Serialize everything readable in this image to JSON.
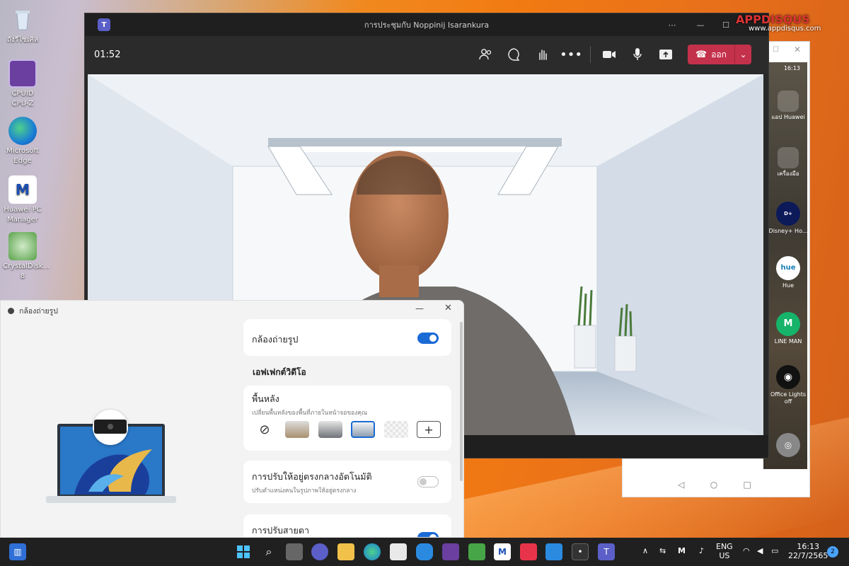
{
  "desktop": {
    "icons": [
      {
        "label": "ถังรีไซเคิล",
        "icon": "recycle-bin-icon"
      },
      {
        "label": "CPUID CPU-Z",
        "icon": "cpuz-icon"
      },
      {
        "label": "Microsoft Edge",
        "icon": "edge-icon"
      },
      {
        "label": "Huawei PC Manager",
        "icon": "huawei-pc-manager-icon"
      },
      {
        "label": "CrystalDisk... 8",
        "icon": "crystaldisk-icon"
      }
    ]
  },
  "teams": {
    "window_title": "การประชุมกับ Noppinij Isarankura",
    "timer": "01:52",
    "leave_label": "ออก",
    "accent": "#c4314b"
  },
  "watermark": {
    "logo": "APPDISQUS",
    "url": "www.appdisqus.com"
  },
  "phone": {
    "status_time": "16:13",
    "apps": [
      {
        "label": "แอป Huawei"
      },
      {
        "label": "เครื่องมือ"
      },
      {
        "label": "Disney+ Ho..."
      },
      {
        "label": "Hue"
      },
      {
        "label": "LINE MAN"
      },
      {
        "label": "Office Lights off"
      }
    ]
  },
  "camera_panel": {
    "title": "กล้องถ่ายรูป",
    "camera_toggle_label": "กล้องถ่ายรูป",
    "camera_on": true,
    "section_title": "เอฟเฟกต์วิดีโอ",
    "background": {
      "title": "พื้นหลัง",
      "subtitle": "เปลี่ยนพื้นหลังของพื้นที่ภายในหน้าจอของคุณ"
    },
    "auto_center": {
      "title": "การปรับให้อยู่ตรงกลางอัตโนมัติ",
      "subtitle": "ปรับตำแหน่งคนในรูปภาพให้อยู่ตรงกลาง",
      "enabled": false
    },
    "eye_contact": {
      "title": "การปรับสายตา",
      "enabled": true
    },
    "accent": "#1a6ad6"
  },
  "taskbar": {
    "lang_top": "ENG",
    "lang_bottom": "US",
    "time": "16:13",
    "date": "22/7/2565",
    "notification_count": "2"
  }
}
